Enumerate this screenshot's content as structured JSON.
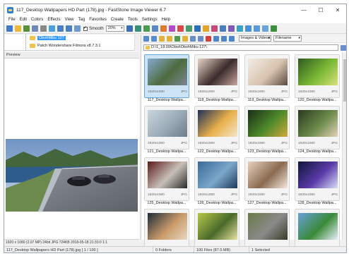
{
  "window": {
    "title": "117_Desktop Wallpapers  HD Part (178).jpg  -  FastStone Image Viewer 6.7",
    "controls": [
      "—",
      "☐",
      "✕"
    ]
  },
  "menu": [
    "File",
    "Edit",
    "Colors",
    "Effects",
    "View",
    "Tag",
    "Favorites",
    "Create",
    "Tools",
    "Settings",
    "Help"
  ],
  "toolbar": {
    "smooth_label": "Smooth",
    "zoom_value": "20%",
    "icons": [
      {
        "name": "open-folder-icon",
        "color": "#3f7bc8"
      },
      {
        "name": "browse-icon",
        "color": "#e8b93a"
      },
      {
        "name": "save-icon",
        "color": "#5a8f3c"
      },
      {
        "name": "email-icon",
        "color": "#6f88b8"
      },
      {
        "name": "print-icon",
        "color": "#888888"
      },
      {
        "name": "scan-icon",
        "color": "#4aa0d8"
      },
      {
        "name": "zoom-in-icon",
        "color": "#4a7fc4"
      },
      {
        "name": "zoom-out-icon",
        "color": "#4a7fc4"
      },
      {
        "name": "actual-size-icon",
        "color": "#6d9bd1"
      }
    ],
    "icons_right": [
      {
        "name": "rotate-left-icon",
        "color": "#3b6fb5"
      },
      {
        "name": "flip-icon",
        "color": "#3a8f7a"
      },
      {
        "name": "crop-icon",
        "color": "#4b9b52"
      },
      {
        "name": "resize-icon",
        "color": "#5c88c6"
      },
      {
        "name": "adjust-color-icon",
        "color": "#e07a2f"
      },
      {
        "name": "sharpen-icon",
        "color": "#b54ac8"
      },
      {
        "name": "red-eye-icon",
        "color": "#d84a4a"
      },
      {
        "name": "clone-icon",
        "color": "#4a9c6c"
      },
      {
        "name": "text-icon",
        "color": "#2e6eb8"
      },
      {
        "name": "effects-icon",
        "color": "#e2a52c"
      },
      {
        "name": "compare-icon",
        "color": "#c84a7a"
      },
      {
        "name": "slideshow-icon",
        "color": "#4c7cc0"
      },
      {
        "name": "batch-icon",
        "color": "#7c5cb8"
      },
      {
        "name": "wallpaper-icon",
        "color": "#3aa2c4"
      },
      {
        "name": "layout-browser-icon",
        "color": "#4a90d9"
      },
      {
        "name": "layout-preview-icon",
        "color": "#5a9ad6"
      },
      {
        "name": "layout-full-icon",
        "color": "#6aa4d9"
      },
      {
        "name": "fullscreen-icon",
        "color": "#3b8f3b"
      }
    ]
  },
  "folder_tree": {
    "items": [
      {
        "label": "ObohMiku 127",
        "selected": true
      },
      {
        "label": "Patch Wondershare Filmora v8.7.3.1",
        "selected": false
      }
    ]
  },
  "preview": {
    "header": "Preview"
  },
  "nav_toolbar": {
    "filter": "Images & Videos",
    "sort": "Filename",
    "icons": [
      {
        "name": "back-icon",
        "color": "#5a8ad0"
      },
      {
        "name": "forward-icon",
        "color": "#5a8ad0"
      },
      {
        "name": "up-folder-icon",
        "color": "#e2b23c"
      },
      {
        "name": "favorite-folder-icon",
        "color": "#e2b23c"
      },
      {
        "name": "refresh-icon",
        "color": "#4c9c4c"
      },
      {
        "name": "folder-tree-icon",
        "color": "#e2b23c"
      },
      {
        "name": "copy-to-icon",
        "color": "#6a8fc8"
      },
      {
        "name": "move-to-icon",
        "color": "#6a8fc8"
      },
      {
        "name": "delete-icon",
        "color": "#d44040"
      },
      {
        "name": "thumbnail-view-icon",
        "color": "#4f86c9"
      },
      {
        "name": "details-view-icon",
        "color": "#4f86c9"
      },
      {
        "name": "list-view-icon",
        "color": "#4f86c9"
      }
    ]
  },
  "path": "D:\\1_18.09\\Oboi\\ObohMiku 127\\",
  "thumbnails": [
    {
      "name": "117_Desktop Wallpa...",
      "size": "1920x1080",
      "type": "JPG",
      "selected": true,
      "colors": [
        "#86a9cf",
        "#4d6b3e",
        "#7c8693"
      ]
    },
    {
      "name": "118_Desktop Wallpa...",
      "size": "1920x1080",
      "type": "JPG",
      "selected": false,
      "colors": [
        "#e9d4c8",
        "#3a2a2a",
        "#c8a6a0"
      ]
    },
    {
      "name": "119_Desktop Wallpa...",
      "size": "1920x1080",
      "type": "JPG",
      "selected": false,
      "colors": [
        "#f2ece4",
        "#d9c4b0",
        "#5a4a40"
      ]
    },
    {
      "name": "120_Desktop Wallpa...",
      "size": "1920x1080",
      "type": "JPG",
      "selected": false,
      "colors": [
        "#2f5a1e",
        "#7ab834",
        "#d8e27a"
      ]
    },
    {
      "name": "121_Desktop Wallpa...",
      "size": "1920x1080",
      "type": "JPG",
      "selected": false,
      "colors": [
        "#c9d6de",
        "#9aaab6",
        "#6c7c88"
      ]
    },
    {
      "name": "122_Desktop Wallpa...",
      "size": "1920x1080",
      "type": "JPG",
      "selected": false,
      "colors": [
        "#1f2f5a",
        "#e8b04a",
        "#f4e6c8"
      ]
    },
    {
      "name": "123_Desktop Wallpa...",
      "size": "1920x1080",
      "type": "JPG",
      "selected": false,
      "colors": [
        "#1a2e14",
        "#4e8a2a",
        "#d2a83a"
      ]
    },
    {
      "name": "124_Desktop Wallpa...",
      "size": "1920x1080",
      "type": "JPG",
      "selected": false,
      "colors": [
        "#2a3a20",
        "#6b8a4a",
        "#e4d2b8"
      ]
    },
    {
      "name": "125_Desktop Wallpa...",
      "size": "1920x1080",
      "type": "JPG",
      "selected": false,
      "colors": [
        "#5a1a1a",
        "#c8c0b8",
        "#2a2a2a"
      ]
    },
    {
      "name": "126_Desktop Wallpa...",
      "size": "1920x1080",
      "type": "JPG",
      "selected": false,
      "colors": [
        "#3a6a9a",
        "#7aa6c8",
        "#1e3a5a"
      ]
    },
    {
      "name": "127_Desktop Wallpa...",
      "size": "1920x1080",
      "type": "JPG",
      "selected": false,
      "colors": [
        "#e6d2c0",
        "#8a6a50",
        "#f4e8de"
      ]
    },
    {
      "name": "128_Desktop Wallpa...",
      "size": "1920x1080",
      "type": "JPG",
      "selected": false,
      "colors": [
        "#0e1638",
        "#5a3aa8",
        "#d8e0f8"
      ]
    },
    {
      "name": "",
      "size": "",
      "type": "",
      "selected": false,
      "colors": [
        "#1e2a3a",
        "#c89a6a",
        "#e8d8c0"
      ]
    },
    {
      "name": "",
      "size": "",
      "type": "",
      "selected": false,
      "colors": [
        "#b8c84a",
        "#4a6a2a",
        "#e8e0a0"
      ]
    },
    {
      "name": "",
      "size": "",
      "type": "",
      "selected": false,
      "colors": [
        "#6a7a4a",
        "#8a8a8a",
        "#3a3a2a"
      ]
    },
    {
      "name": "",
      "size": "",
      "type": "",
      "selected": false,
      "colors": [
        "#6aa0d8",
        "#3a8a3a",
        "#e8f0f8"
      ]
    }
  ],
  "info_bar": "1920 x 1080 (2.07 MP)  24bit  JPG  724KB  2018-05-18 21:33:0 1:1",
  "status": {
    "file": "117_Desktop Wallpapers  HD Part (178).jpg  [ 1 / 100 ]",
    "folders": "0 Folders",
    "files": "100 Files (87.5 MB)",
    "selected": "1 Selected"
  }
}
